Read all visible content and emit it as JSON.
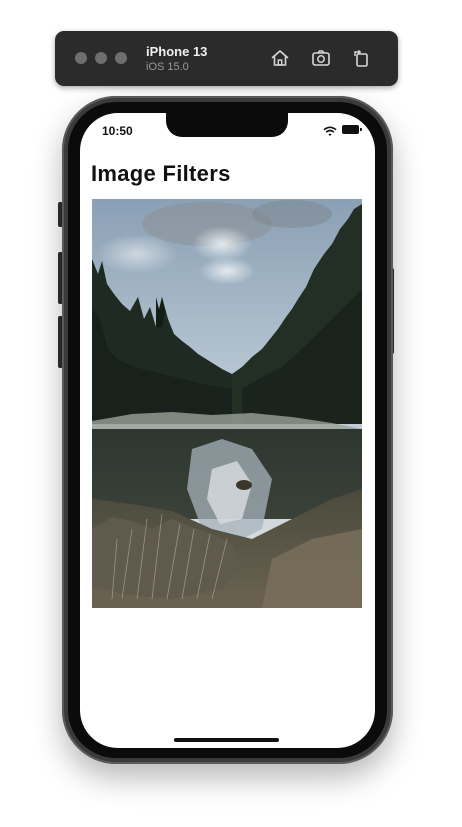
{
  "simulator": {
    "device_name": "iPhone 13",
    "os_version": "iOS 15.0"
  },
  "status_bar": {
    "time": "10:50"
  },
  "screen": {
    "title": "Image Filters"
  },
  "colors": {
    "toolbar_bg": "#2b2b2b",
    "phone_frame": "#3a3a3a",
    "bezel": "#0b0b0b",
    "screen_bg": "#ffffff",
    "text": "#111111"
  },
  "icons": [
    "home-icon",
    "screenshot-icon",
    "rotate-icon",
    "wifi-icon",
    "battery-icon"
  ]
}
